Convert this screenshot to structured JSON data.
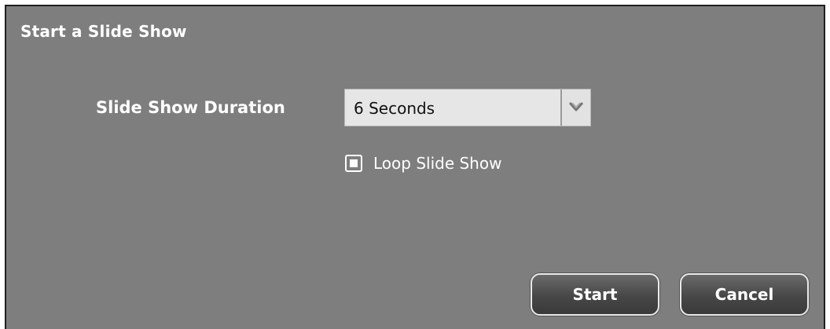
{
  "dialog": {
    "title": "Start a Slide Show"
  },
  "duration": {
    "label": "Slide Show Duration",
    "selected_value": "6 Seconds",
    "dropdown_icon": "chevron-down-icon"
  },
  "loop": {
    "label": "Loop Slide Show",
    "checked": true
  },
  "buttons": {
    "start_label": "Start",
    "cancel_label": "Cancel"
  },
  "colors": {
    "dialog_background": "#7e7e7e",
    "text": "#ffffff",
    "button_background": "#474747",
    "select_background": "#e6e6e6"
  }
}
